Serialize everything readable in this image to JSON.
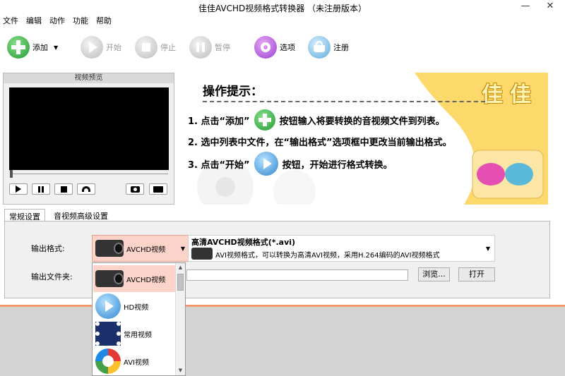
{
  "window": {
    "title": "佳佳AVCHD视频格式转换器  （未注册版本）",
    "minimize": "—",
    "close": "✕"
  },
  "menu": [
    "文件",
    "编辑",
    "动作",
    "功能",
    "帮助"
  ],
  "toolbar": {
    "add": "添加",
    "start": "开始",
    "stop": "停止",
    "pause": "暂停",
    "options": "选项",
    "register": "注册"
  },
  "preview": {
    "caption": "视频预览"
  },
  "banner": {
    "title": "操作提示：",
    "brand": "佳佳",
    "step1a": "1. 点击“添加”",
    "step1b": "按钮输入将要转换的音视频文件到列表。",
    "step2": "2. 选中列表中文件，在“输出格式”选项框中更改当前输出格式。",
    "step3a": "3. 点击“开始”",
    "step3b": "按钮，开始进行格式转换。"
  },
  "tabs": [
    "常规设置",
    "音视频高级设置"
  ],
  "settings": {
    "output_format_label": "输出格式:",
    "output_folder_label": "输出文件夹:",
    "selected_format": "AVCHD视频",
    "format_title": "高清AVCHD视频格式(*.avi)",
    "format_desc": "AVI视频格式，可以转换为高清AVI视频，采用H.264编码的AVI视频格式",
    "browse": "浏览...",
    "open": "打开",
    "output_folder_value": ""
  },
  "dropdown": {
    "items": [
      "AVCHD视频",
      "HD视频",
      "常用视频",
      "AVI视频"
    ],
    "selected_index": 0
  },
  "colors": {
    "accent_selection": "#fbd3c9",
    "banner_yellow": "#fdd86a",
    "separator": "#f39b6d"
  }
}
